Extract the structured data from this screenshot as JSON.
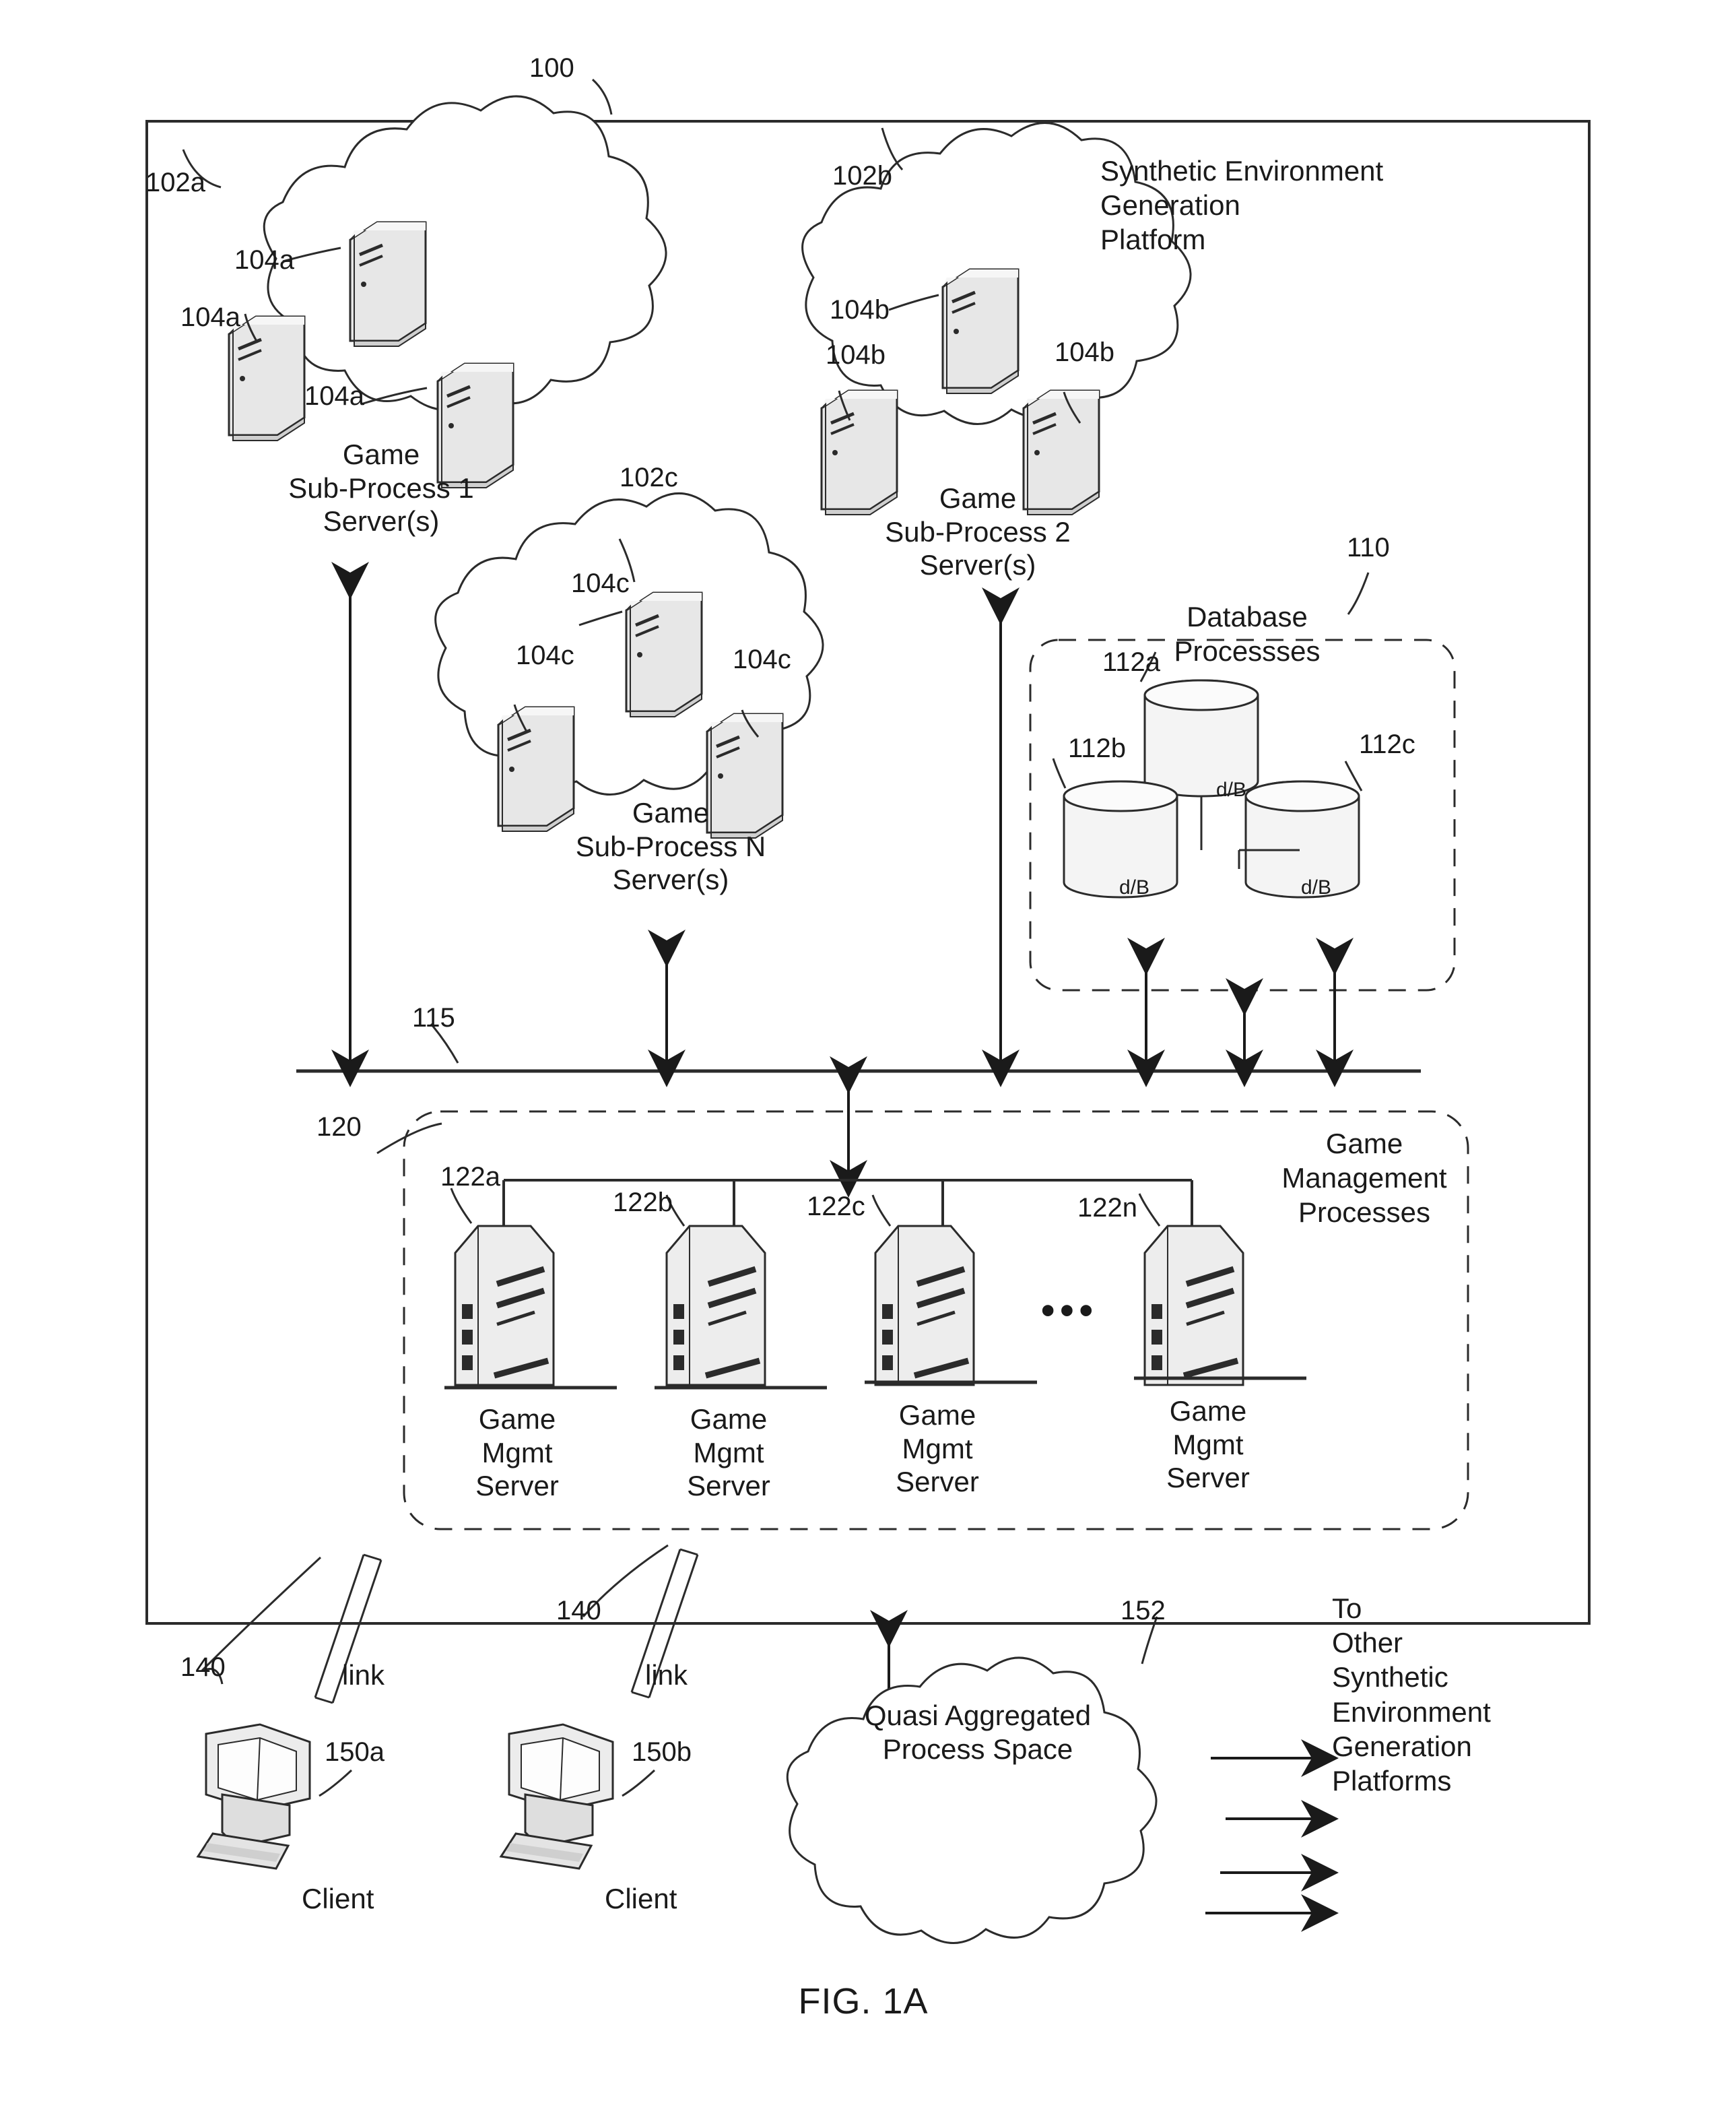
{
  "figure": {
    "caption": "FIG. 1A",
    "outer_ref": "100",
    "platform_title": "Synthetic Environment\nGeneration\nPlatform"
  },
  "subprocess_clouds": [
    {
      "ref": "102a",
      "caption": "Game\nSub-Process 1\nServer(s)",
      "server_refs": [
        "104a",
        "104a",
        "104a"
      ],
      "server_count": 3
    },
    {
      "ref": "102b",
      "caption": "Game\nSub-Process 2\nServer(s)",
      "server_refs": [
        "104b",
        "104b",
        "104b"
      ],
      "server_count": 3
    },
    {
      "ref": "102c",
      "caption": "Game\nSub-Process N\nServer(s)",
      "server_refs": [
        "104c",
        "104c",
        "104c"
      ],
      "server_count": 3
    }
  ],
  "database_group": {
    "ref": "110",
    "title": "Database\nProcessses",
    "db_refs": [
      "112a",
      "112b",
      "112c"
    ],
    "db_label": "d/B"
  },
  "bus": {
    "ref": "115"
  },
  "management_group": {
    "ref": "120",
    "title": "Game\nManagement\nProcesses",
    "ellipsis": "•••",
    "servers": [
      {
        "ref": "122a",
        "caption": "Game\nMgmt\nServer"
      },
      {
        "ref": "122b",
        "caption": "Game\nMgmt\nServer"
      },
      {
        "ref": "122c",
        "caption": "Game\nMgmt\nServer"
      },
      {
        "ref": "122n",
        "caption": "Game\nMgmt\nServer"
      }
    ]
  },
  "clients": [
    {
      "link_ref": "140",
      "link_label": "link",
      "ref": "150a",
      "caption": "Client"
    },
    {
      "link_ref": "140",
      "link_label": "link",
      "ref": "150b",
      "caption": "Client"
    }
  ],
  "process_space": {
    "ref": "152",
    "caption": "Quasi Aggregated\nProcess Space",
    "destination": "To\nOther\nSynthetic\nEnvironment\nGeneration\nPlatforms",
    "arrow_count": 4
  },
  "colors": {
    "ink": "#1a1a1a",
    "line": "#2b2b2b",
    "shade": "#d8d8d8",
    "shade_light": "#eeeeee",
    "paper": "#ffffff"
  }
}
